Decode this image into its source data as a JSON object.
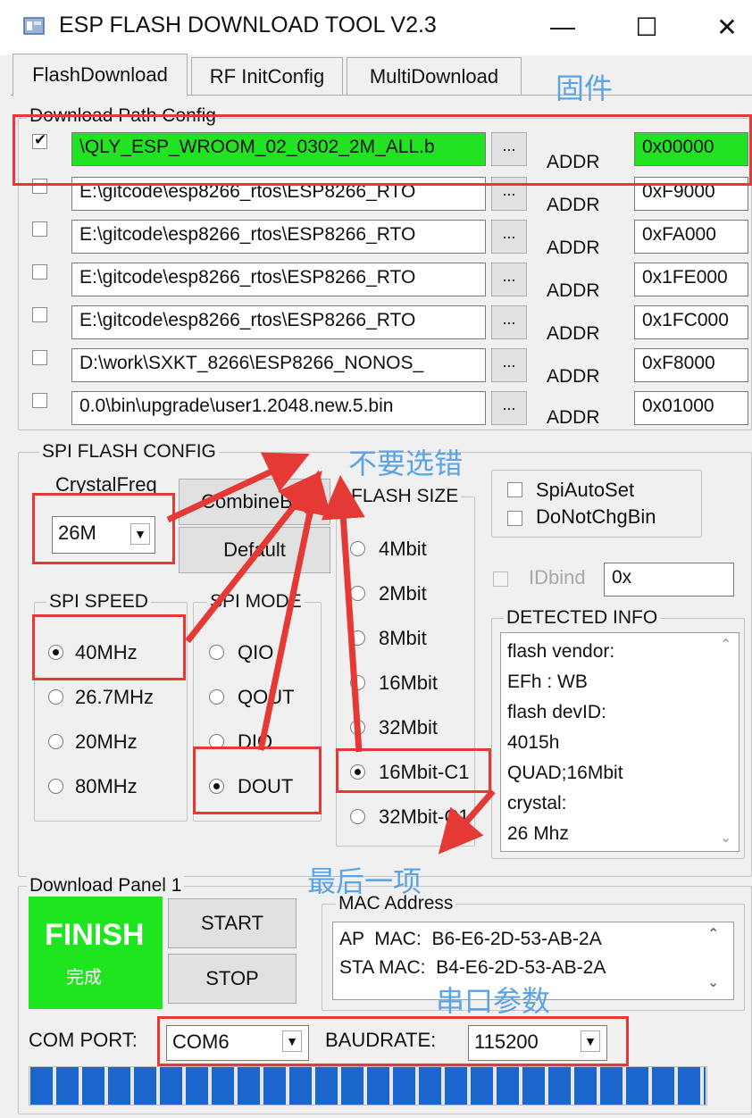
{
  "window": {
    "title": "ESP FLASH DOWNLOAD TOOL V2.3",
    "minimize_glyph": "—",
    "maximize_glyph": "☐",
    "close_glyph": "✕"
  },
  "tabs": [
    {
      "label": "FlashDownload",
      "active": true
    },
    {
      "label": "RF InitConfig",
      "active": false
    },
    {
      "label": "MultiDownload",
      "active": false
    }
  ],
  "download_path_config": {
    "label": "Download Path Config",
    "browse_label": "...",
    "addr_label": "ADDR",
    "rows": [
      {
        "checked": true,
        "path": "\\QLY_ESP_WROOM_02_0302_2M_ALL.b",
        "addr": "0x00000",
        "highlight": true
      },
      {
        "checked": false,
        "path": "E:\\gitcode\\esp8266_rtos\\ESP8266_RTO",
        "addr": "0xF9000",
        "highlight": false
      },
      {
        "checked": false,
        "path": "E:\\gitcode\\esp8266_rtos\\ESP8266_RTO",
        "addr": "0xFA000",
        "highlight": false
      },
      {
        "checked": false,
        "path": "E:\\gitcode\\esp8266_rtos\\ESP8266_RTO",
        "addr": "0x1FE000",
        "highlight": false
      },
      {
        "checked": false,
        "path": "E:\\gitcode\\esp8266_rtos\\ESP8266_RTO",
        "addr": "0x1FC000",
        "highlight": false
      },
      {
        "checked": false,
        "path": "D:\\work\\SXKT_8266\\ESP8266_NONOS_",
        "addr": "0xF8000",
        "highlight": false
      },
      {
        "checked": false,
        "path": "0.0\\bin\\upgrade\\user1.2048.new.5.bin",
        "addr": "0x01000",
        "highlight": false
      }
    ]
  },
  "spi_flash_config": {
    "label": "SPI FLASH CONFIG",
    "crystal_freq_label": "CrystalFreq",
    "crystal_freq_value": "26M",
    "combine_bin_label": "CombineBin",
    "default_label": "Default",
    "spi_speed": {
      "label": "SPI SPEED",
      "options": [
        "40MHz",
        "26.7MHz",
        "20MHz",
        "80MHz"
      ],
      "selected": "40MHz"
    },
    "spi_mode": {
      "label": "SPI MODE",
      "options": [
        "QIO",
        "QOUT",
        "DIO",
        "DOUT"
      ],
      "selected": "DOUT"
    },
    "flash_size": {
      "label": "FLASH SIZE",
      "options": [
        "4Mbit",
        "2Mbit",
        "8Mbit",
        "16Mbit",
        "32Mbit",
        "16Mbit-C1",
        "32Mbit-C1"
      ],
      "selected": "16Mbit-C1"
    },
    "spi_auto_set_label": "SpiAutoSet",
    "do_not_chg_bin_label": "DoNotChgBin",
    "idbind_label": "IDbind",
    "idbind_value": "0x",
    "detected_info": {
      "label": "DETECTED INFO",
      "lines": [
        "flash vendor:",
        "EFh : WB",
        "flash devID:",
        "4015h",
        "QUAD;16Mbit",
        "crystal:",
        "26 Mhz"
      ]
    }
  },
  "download_panel": {
    "label": "Download Panel 1",
    "status_en": "FINISH",
    "status_cn": "完成",
    "start_label": "START",
    "stop_label": "STOP",
    "mac_label": "MAC Address",
    "ap_mac": "AP  MAC:  B6-E6-2D-53-AB-2A",
    "sta_mac": "STA MAC:  B4-E6-2D-53-AB-2A",
    "com_port_label": "COM PORT:",
    "com_port_value": "COM6",
    "baudrate_label": "BAUDRATE:",
    "baudrate_value": "115200",
    "progress": 1.0
  },
  "annotations": {
    "firmware": "固件",
    "dont_choose_wrong": "不要选错",
    "last_item": "最后一项",
    "serial_params": "串口参数"
  },
  "colors": {
    "highlight_green": "#22e322",
    "finish_green": "#1ee51e",
    "progress_blue": "#1a66cc",
    "annotation_red": "#e53935",
    "annotation_blue": "#5aa3e6"
  }
}
